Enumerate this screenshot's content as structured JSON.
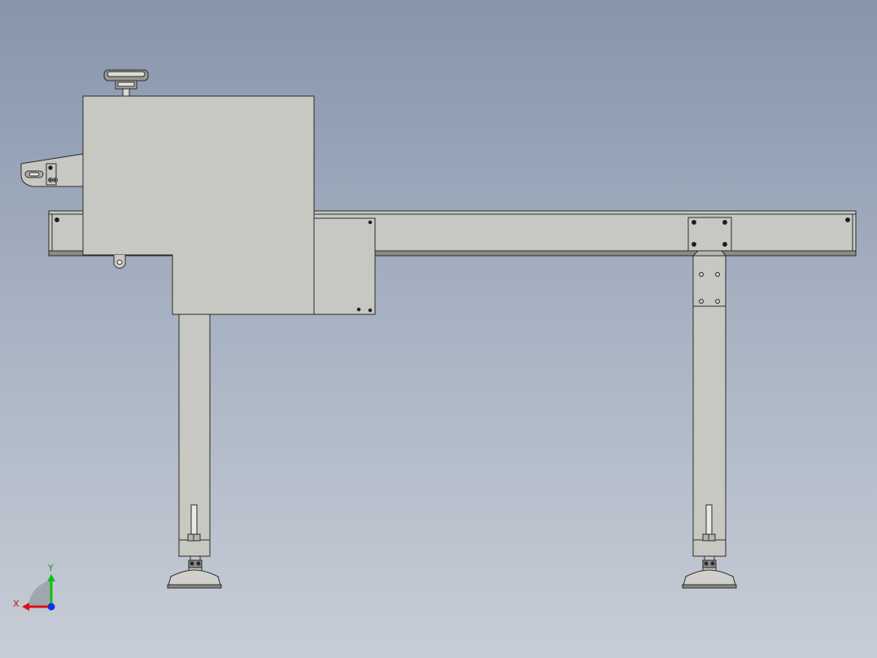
{
  "viewport": {
    "background_top": "#8795ab",
    "background_bottom": "#c7cdd6",
    "part_fill": "#c8c8c2",
    "edge_color": "#2a2a2a",
    "bolt_color": "#1a1a1a"
  },
  "model": {
    "components": [
      "conveyor-frame-beam",
      "drive-enclosure",
      "enclosure-lower-block",
      "side-cover-plate",
      "motor-bracket",
      "top-handwheel",
      "hanging-loop",
      "leg-left",
      "leg-right",
      "mounting-plate",
      "leveling-foot-left",
      "leveling-foot-right"
    ]
  },
  "triad": {
    "x_label": "X",
    "y_label": "Y",
    "x_color": "#e01010",
    "y_color": "#10c010",
    "z_color": "#1030e0"
  }
}
